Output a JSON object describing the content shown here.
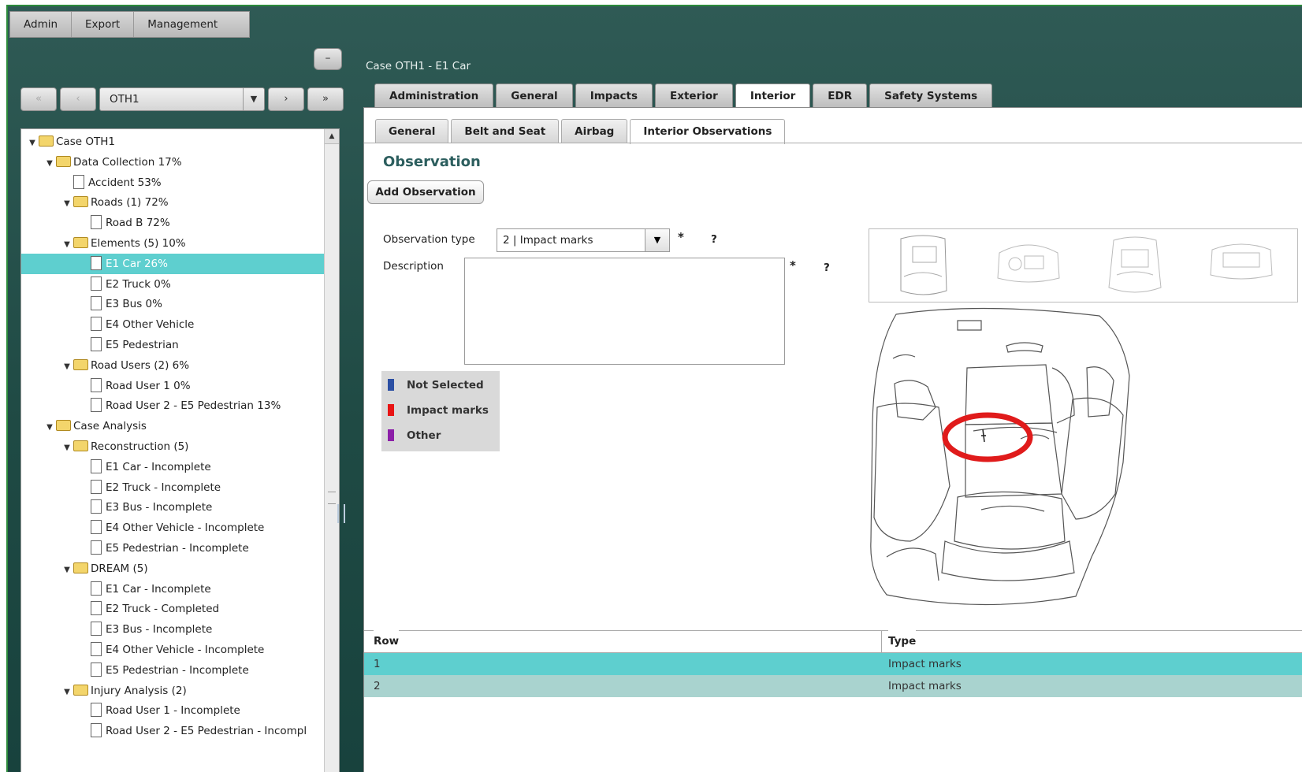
{
  "menu": [
    "Admin",
    "Export",
    "Management"
  ],
  "collapse_label": "–",
  "nav": {
    "first": "«",
    "prev": "‹",
    "selected": "OTH1",
    "dropdown_arrow": "▼",
    "next": "›",
    "last": "»"
  },
  "tree": [
    {
      "label": "Case OTH1",
      "level": 0,
      "type": "folder",
      "expanded": true
    },
    {
      "label": "Data Collection 17%",
      "level": 1,
      "type": "folder",
      "expanded": true
    },
    {
      "label": "Accident 53%",
      "level": 2,
      "type": "doc"
    },
    {
      "label": "Roads (1) 72%",
      "level": 2,
      "type": "folder",
      "expanded": true
    },
    {
      "label": "Road B 72%",
      "level": 3,
      "type": "doc"
    },
    {
      "label": "Elements (5) 10%",
      "level": 2,
      "type": "folder",
      "expanded": true
    },
    {
      "label": "E1 Car 26%",
      "level": 3,
      "type": "doc",
      "selected": true
    },
    {
      "label": "E2 Truck 0%",
      "level": 3,
      "type": "doc"
    },
    {
      "label": "E3 Bus 0%",
      "level": 3,
      "type": "doc"
    },
    {
      "label": "E4 Other Vehicle",
      "level": 3,
      "type": "doc"
    },
    {
      "label": "E5 Pedestrian",
      "level": 3,
      "type": "doc"
    },
    {
      "label": "Road Users (2) 6%",
      "level": 2,
      "type": "folder",
      "expanded": true
    },
    {
      "label": "Road User 1 0%",
      "level": 3,
      "type": "doc"
    },
    {
      "label": "Road User 2 - E5 Pedestrian 13%",
      "level": 3,
      "type": "doc"
    },
    {
      "label": "Case Analysis",
      "level": 1,
      "type": "folder",
      "expanded": true
    },
    {
      "label": "Reconstruction (5)",
      "level": 2,
      "type": "folder",
      "expanded": true
    },
    {
      "label": "E1 Car - Incomplete",
      "level": 3,
      "type": "doc"
    },
    {
      "label": "E2 Truck - Incomplete",
      "level": 3,
      "type": "doc"
    },
    {
      "label": "E3 Bus - Incomplete",
      "level": 3,
      "type": "doc"
    },
    {
      "label": "E4 Other Vehicle - Incomplete",
      "level": 3,
      "type": "doc"
    },
    {
      "label": "E5 Pedestrian - Incomplete",
      "level": 3,
      "type": "doc"
    },
    {
      "label": "DREAM (5)",
      "level": 2,
      "type": "folder",
      "expanded": true
    },
    {
      "label": "E1 Car - Incomplete",
      "level": 3,
      "type": "doc"
    },
    {
      "label": "E2 Truck - Completed",
      "level": 3,
      "type": "doc"
    },
    {
      "label": "E3 Bus - Incomplete",
      "level": 3,
      "type": "doc"
    },
    {
      "label": "E4 Other Vehicle - Incomplete",
      "level": 3,
      "type": "doc"
    },
    {
      "label": "E5 Pedestrian - Incomplete",
      "level": 3,
      "type": "doc"
    },
    {
      "label": "Injury Analysis (2)",
      "level": 2,
      "type": "folder",
      "expanded": true
    },
    {
      "label": "Road User 1 - Incomplete",
      "level": 3,
      "type": "doc"
    },
    {
      "label": "Road User 2 - E5 Pedestrian - Incompl",
      "level": 3,
      "type": "doc"
    }
  ],
  "case_title": "Case OTH1 - E1 Car",
  "main_tabs": [
    {
      "label": "Administration"
    },
    {
      "label": "General"
    },
    {
      "label": "Impacts"
    },
    {
      "label": "Exterior"
    },
    {
      "label": "Interior",
      "active": true
    },
    {
      "label": "EDR"
    },
    {
      "label": "Safety Systems"
    }
  ],
  "sub_tabs": [
    {
      "label": "General"
    },
    {
      "label": "Belt and Seat"
    },
    {
      "label": "Airbag"
    },
    {
      "label": "Interior Observations",
      "active": true
    }
  ],
  "observation": {
    "title": "Observation",
    "add_button": "Add Observation",
    "type_label": "Observation type",
    "type_value": "2 | Impact marks",
    "type_arrow": "▼",
    "description_label": "Description",
    "description_value": "",
    "required_mark": "*",
    "help_mark": "?"
  },
  "legend": [
    {
      "label": "Not Selected",
      "color": "#2b4fa3"
    },
    {
      "label": "Impact marks",
      "color": "#e81414"
    },
    {
      "label": "Other",
      "color": "#8c1fa8"
    }
  ],
  "thumbnails_active_index": 0,
  "marker_color": "#e01b1b",
  "table": {
    "headers": [
      "Row",
      "Type"
    ],
    "rows": [
      {
        "row": "1",
        "type": "Impact marks",
        "selected": true
      },
      {
        "row": "2",
        "type": "Impact marks"
      }
    ]
  }
}
